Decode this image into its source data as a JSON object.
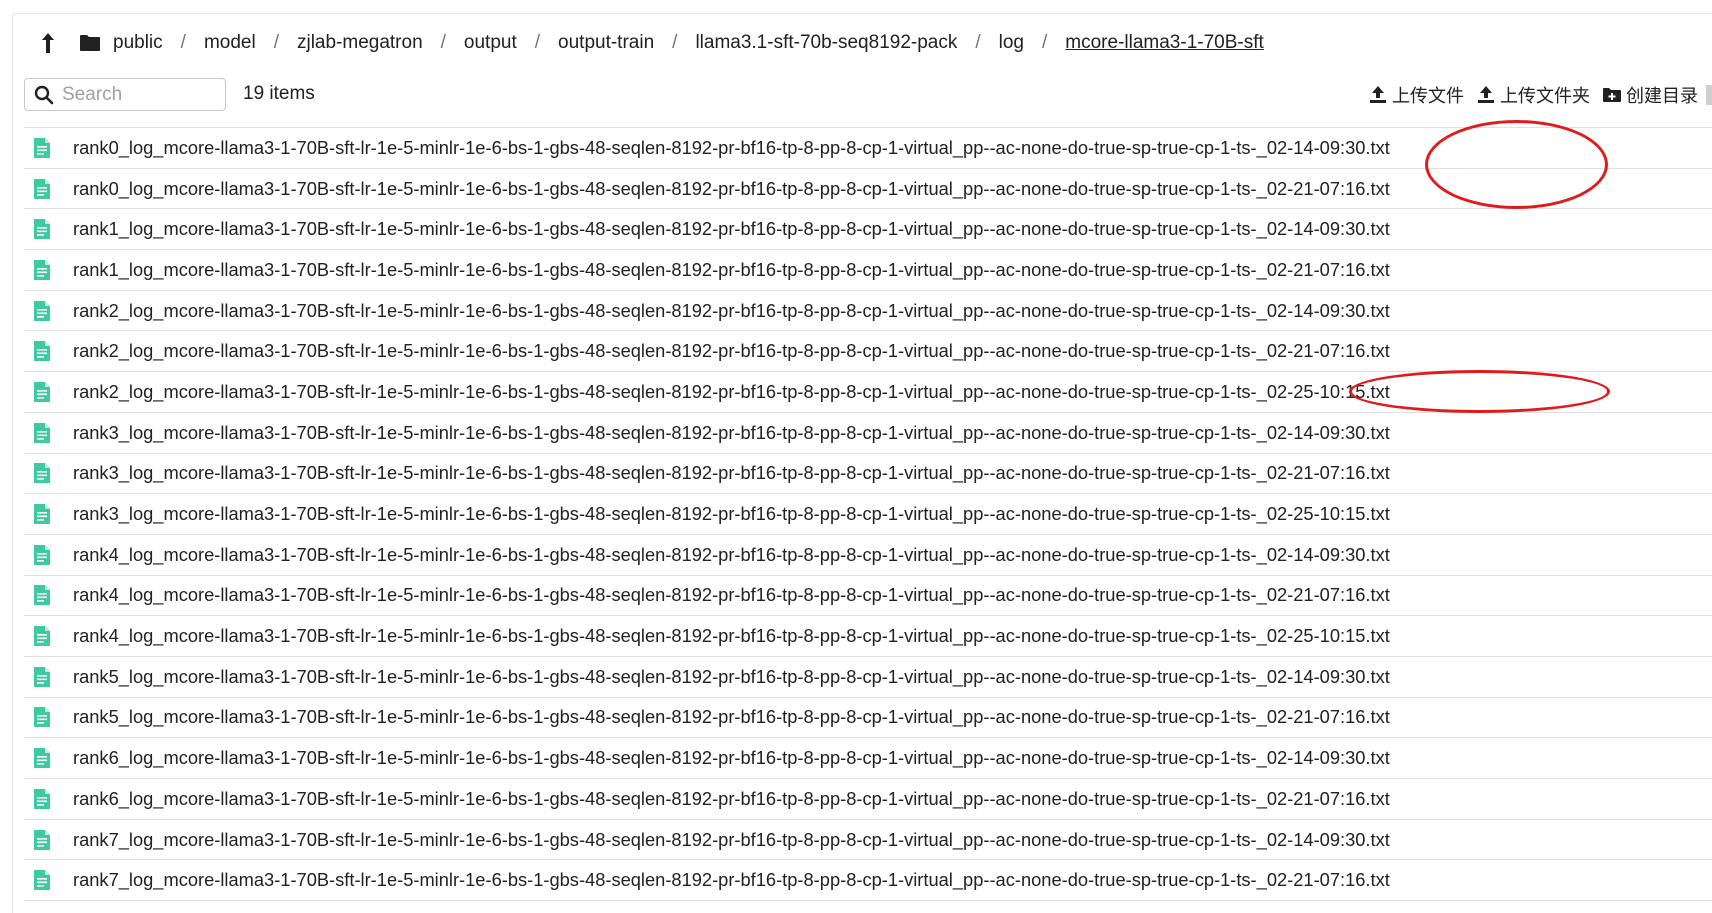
{
  "breadcrumb": {
    "home": "public",
    "items": [
      "model",
      "zjlab-megatron",
      "output",
      "output-train",
      "llama3.1-sft-70b-seq8192-pack",
      "log"
    ],
    "current": "mcore-llama3-1-70B-sft",
    "separator": "/"
  },
  "search": {
    "placeholder": "Search",
    "value": ""
  },
  "item_count": "19 items",
  "toolbar": {
    "upload_file": "上传文件",
    "upload_folder": "上传文件夹",
    "create_dir": "创建目录"
  },
  "files": [
    "rank0_log_mcore-llama3-1-70B-sft-lr-1e-5-minlr-1e-6-bs-1-gbs-48-seqlen-8192-pr-bf16-tp-8-pp-8-cp-1-virtual_pp--ac-none-do-true-sp-true-cp-1-ts-_02-14-09:30.txt",
    "rank0_log_mcore-llama3-1-70B-sft-lr-1e-5-minlr-1e-6-bs-1-gbs-48-seqlen-8192-pr-bf16-tp-8-pp-8-cp-1-virtual_pp--ac-none-do-true-sp-true-cp-1-ts-_02-21-07:16.txt",
    "rank1_log_mcore-llama3-1-70B-sft-lr-1e-5-minlr-1e-6-bs-1-gbs-48-seqlen-8192-pr-bf16-tp-8-pp-8-cp-1-virtual_pp--ac-none-do-true-sp-true-cp-1-ts-_02-14-09:30.txt",
    "rank1_log_mcore-llama3-1-70B-sft-lr-1e-5-minlr-1e-6-bs-1-gbs-48-seqlen-8192-pr-bf16-tp-8-pp-8-cp-1-virtual_pp--ac-none-do-true-sp-true-cp-1-ts-_02-21-07:16.txt",
    "rank2_log_mcore-llama3-1-70B-sft-lr-1e-5-minlr-1e-6-bs-1-gbs-48-seqlen-8192-pr-bf16-tp-8-pp-8-cp-1-virtual_pp--ac-none-do-true-sp-true-cp-1-ts-_02-14-09:30.txt",
    "rank2_log_mcore-llama3-1-70B-sft-lr-1e-5-minlr-1e-6-bs-1-gbs-48-seqlen-8192-pr-bf16-tp-8-pp-8-cp-1-virtual_pp--ac-none-do-true-sp-true-cp-1-ts-_02-21-07:16.txt",
    "rank2_log_mcore-llama3-1-70B-sft-lr-1e-5-minlr-1e-6-bs-1-gbs-48-seqlen-8192-pr-bf16-tp-8-pp-8-cp-1-virtual_pp--ac-none-do-true-sp-true-cp-1-ts-_02-25-10:15.txt",
    "rank3_log_mcore-llama3-1-70B-sft-lr-1e-5-minlr-1e-6-bs-1-gbs-48-seqlen-8192-pr-bf16-tp-8-pp-8-cp-1-virtual_pp--ac-none-do-true-sp-true-cp-1-ts-_02-14-09:30.txt",
    "rank3_log_mcore-llama3-1-70B-sft-lr-1e-5-minlr-1e-6-bs-1-gbs-48-seqlen-8192-pr-bf16-tp-8-pp-8-cp-1-virtual_pp--ac-none-do-true-sp-true-cp-1-ts-_02-21-07:16.txt",
    "rank3_log_mcore-llama3-1-70B-sft-lr-1e-5-minlr-1e-6-bs-1-gbs-48-seqlen-8192-pr-bf16-tp-8-pp-8-cp-1-virtual_pp--ac-none-do-true-sp-true-cp-1-ts-_02-25-10:15.txt",
    "rank4_log_mcore-llama3-1-70B-sft-lr-1e-5-minlr-1e-6-bs-1-gbs-48-seqlen-8192-pr-bf16-tp-8-pp-8-cp-1-virtual_pp--ac-none-do-true-sp-true-cp-1-ts-_02-14-09:30.txt",
    "rank4_log_mcore-llama3-1-70B-sft-lr-1e-5-minlr-1e-6-bs-1-gbs-48-seqlen-8192-pr-bf16-tp-8-pp-8-cp-1-virtual_pp--ac-none-do-true-sp-true-cp-1-ts-_02-21-07:16.txt",
    "rank4_log_mcore-llama3-1-70B-sft-lr-1e-5-minlr-1e-6-bs-1-gbs-48-seqlen-8192-pr-bf16-tp-8-pp-8-cp-1-virtual_pp--ac-none-do-true-sp-true-cp-1-ts-_02-25-10:15.txt",
    "rank5_log_mcore-llama3-1-70B-sft-lr-1e-5-minlr-1e-6-bs-1-gbs-48-seqlen-8192-pr-bf16-tp-8-pp-8-cp-1-virtual_pp--ac-none-do-true-sp-true-cp-1-ts-_02-14-09:30.txt",
    "rank5_log_mcore-llama3-1-70B-sft-lr-1e-5-minlr-1e-6-bs-1-gbs-48-seqlen-8192-pr-bf16-tp-8-pp-8-cp-1-virtual_pp--ac-none-do-true-sp-true-cp-1-ts-_02-21-07:16.txt",
    "rank6_log_mcore-llama3-1-70B-sft-lr-1e-5-minlr-1e-6-bs-1-gbs-48-seqlen-8192-pr-bf16-tp-8-pp-8-cp-1-virtual_pp--ac-none-do-true-sp-true-cp-1-ts-_02-14-09:30.txt",
    "rank6_log_mcore-llama3-1-70B-sft-lr-1e-5-minlr-1e-6-bs-1-gbs-48-seqlen-8192-pr-bf16-tp-8-pp-8-cp-1-virtual_pp--ac-none-do-true-sp-true-cp-1-ts-_02-21-07:16.txt",
    "rank7_log_mcore-llama3-1-70B-sft-lr-1e-5-minlr-1e-6-bs-1-gbs-48-seqlen-8192-pr-bf16-tp-8-pp-8-cp-1-virtual_pp--ac-none-do-true-sp-true-cp-1-ts-_02-14-09:30.txt",
    "rank7_log_mcore-llama3-1-70B-sft-lr-1e-5-minlr-1e-6-bs-1-gbs-48-seqlen-8192-pr-bf16-tp-8-pp-8-cp-1-virtual_pp--ac-none-do-true-sp-true-cp-1-ts-_02-21-07:16.txt"
  ],
  "icons": {
    "up": "arrow-up-icon",
    "home": "folder-icon",
    "search": "search-icon",
    "upload_file": "upload-icon",
    "upload_folder": "upload-icon",
    "create_dir": "new-folder-icon",
    "file": "text-file-icon"
  },
  "colors": {
    "file_icon": "#3fc9a0",
    "annotation": "#e01b1b",
    "text": "#212121",
    "divider": "#e0e0e0"
  }
}
